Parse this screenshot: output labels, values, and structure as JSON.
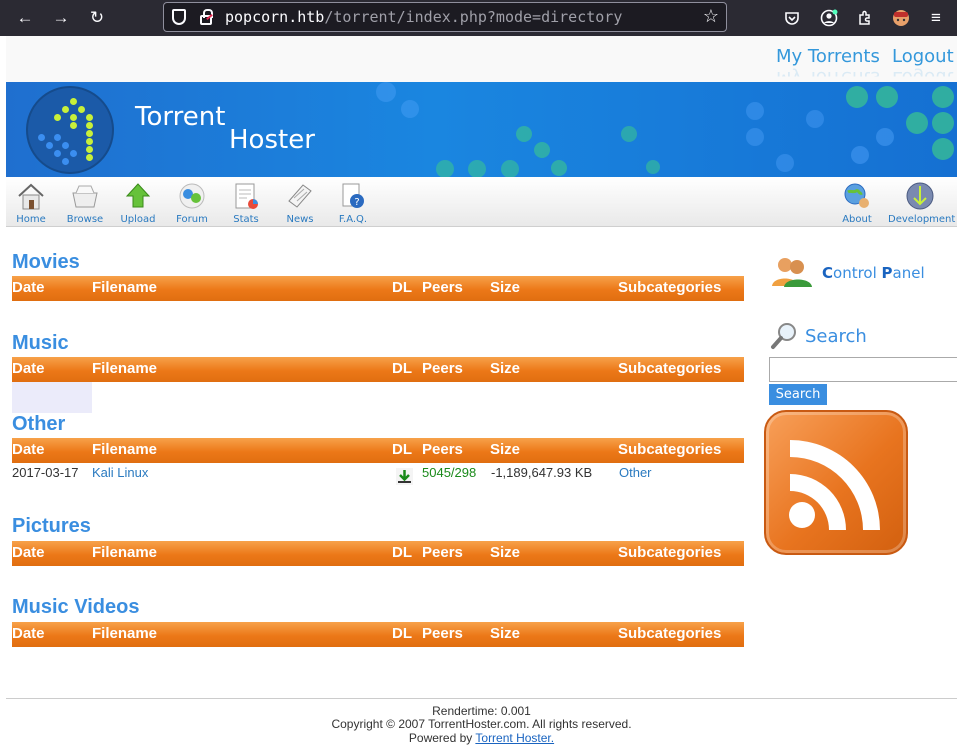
{
  "browser": {
    "url_host": "popcorn.htb",
    "url_path": "/torrent/index.php?mode=directory"
  },
  "top_links": {
    "my_torrents": "My Torrents",
    "logout": "Logout"
  },
  "banner": {
    "title_line1": "Torrent",
    "title_line2": "Hoster"
  },
  "nav": {
    "home": "Home",
    "browse": "Browse",
    "upload": "Upload",
    "forum": "Forum",
    "stats": "Stats",
    "news": "News",
    "faq": "F.A.Q.",
    "about": "About",
    "development": "Development"
  },
  "columns": {
    "date": "Date",
    "filename": "Filename",
    "dl": "DL",
    "peers": "Peers",
    "size": "Size",
    "subcategories": "Subcategories"
  },
  "categories": [
    {
      "name": "Movies"
    },
    {
      "name": "Music"
    },
    {
      "name": "Other",
      "rows": [
        {
          "date": "2017-03-17",
          "filename": "Kali Linux",
          "peers": "5045/298",
          "size": "-1,189,647.93 KB",
          "subcategory": "Other"
        }
      ]
    },
    {
      "name": "Pictures"
    },
    {
      "name": "Music Videos"
    }
  ],
  "sidebar": {
    "control_panel_c": "C",
    "control_panel_mid": "ontrol ",
    "control_panel_p": "P",
    "control_panel_end": "anel",
    "search_label": "Search",
    "search_button": "Search",
    "search_value": ""
  },
  "footer": {
    "rendertime": "Rendertime: 0.001",
    "copyright": "Copyright © 2007 TorrentHoster.com. All rights reserved.",
    "powered_prefix": "Powered by",
    "powered_link": "Torrent Hoster."
  },
  "colors": {
    "accent": "#3a8ee0",
    "bar_orange": "#ec7818",
    "peers_green": "#1a8a1a"
  }
}
